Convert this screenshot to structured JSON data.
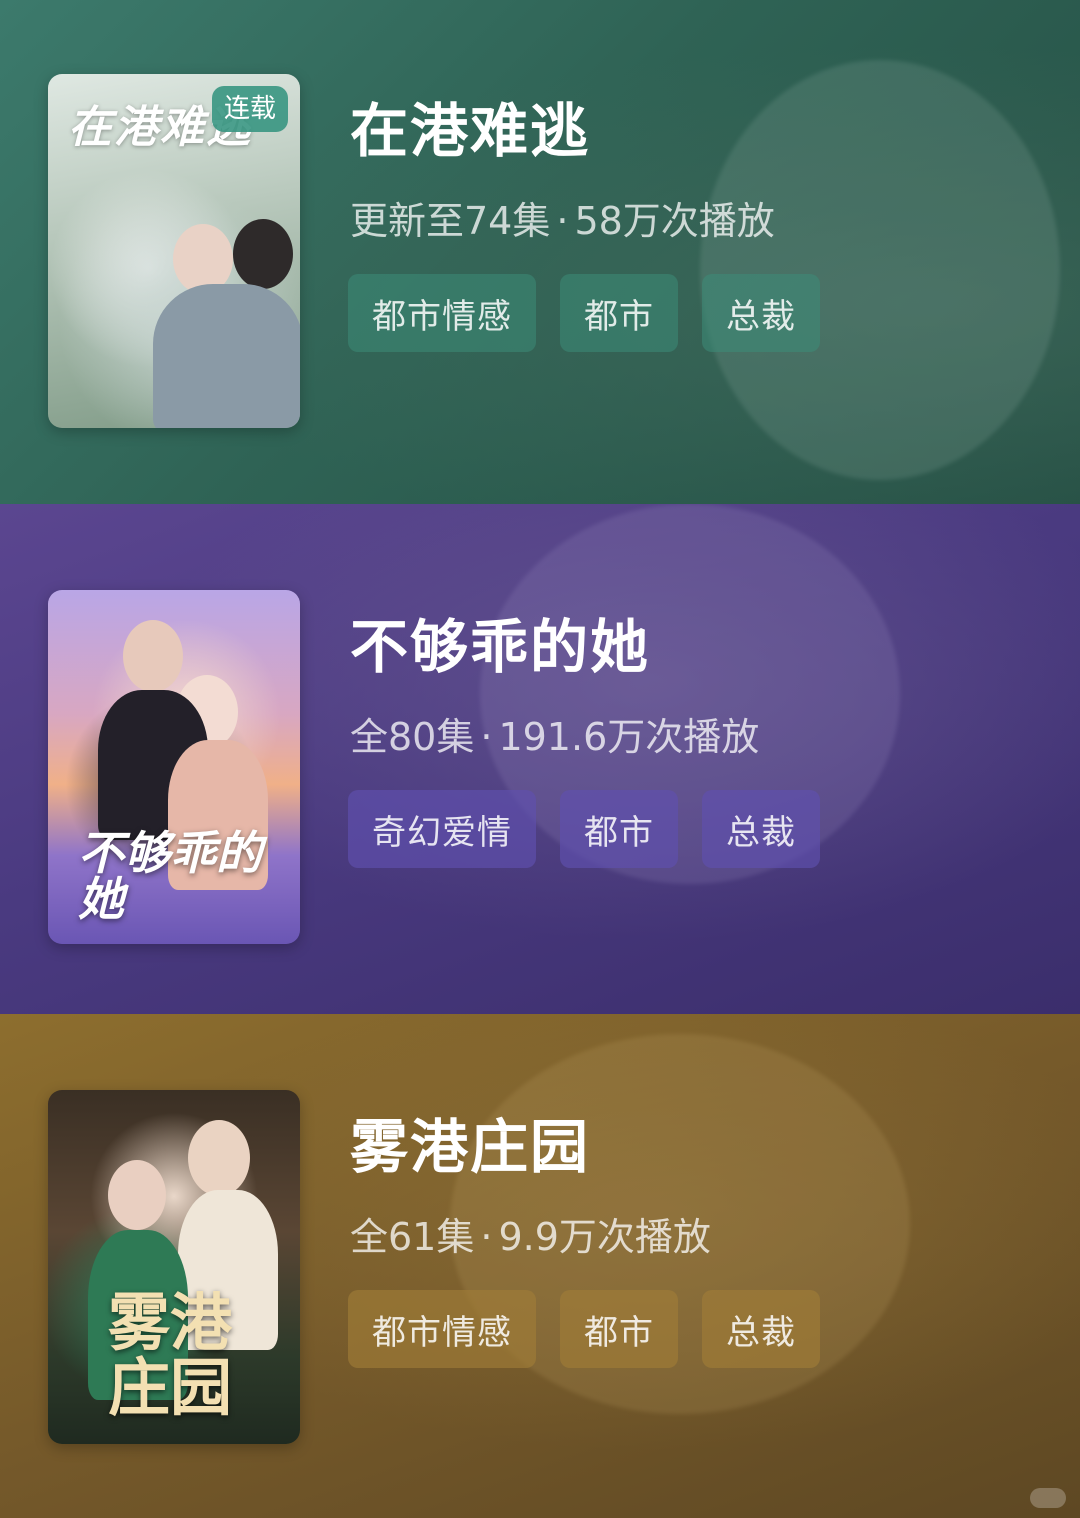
{
  "dramas": [
    {
      "title": "在港难逃",
      "episodes": "更新至74集",
      "plays": "58万次播放",
      "badge": "连载",
      "poster_title": "在港难逃",
      "tags": [
        "都市情感",
        "都市",
        "总裁"
      ]
    },
    {
      "title": "不够乖的她",
      "episodes": "全80集",
      "plays": "191.6万次播放",
      "poster_title": "不够乖的她",
      "tags": [
        "奇幻爱情",
        "都市",
        "总裁"
      ]
    },
    {
      "title": "雾港庄园",
      "episodes": "全61集",
      "plays": "9.9万次播放",
      "poster_title": "雾港庄园",
      "tags": [
        "都市情感",
        "都市",
        "总裁"
      ]
    }
  ],
  "separator": "·",
  "colors": {
    "card1": "#2f6355",
    "card2": "#4a3a80",
    "card3": "#75592a"
  }
}
